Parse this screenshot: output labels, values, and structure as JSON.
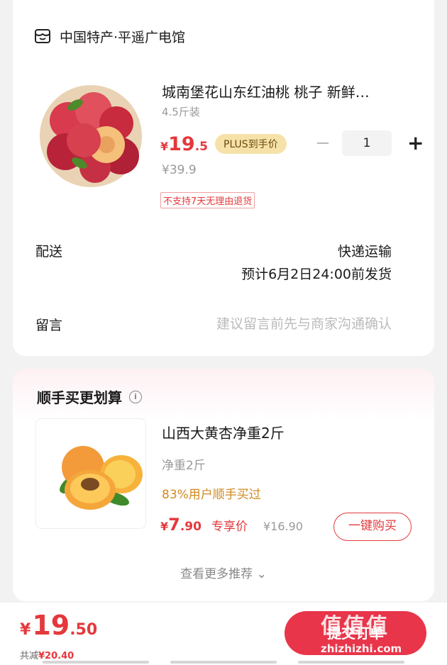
{
  "shop": {
    "icon": "shop-icon",
    "name": "中国特产·平遥广电馆"
  },
  "product": {
    "title": "城南堡花山东红油桃 桃子 新鲜…",
    "spec": "4.5斤装",
    "price_currency": "¥",
    "price_int": "19",
    "price_dec": ".5",
    "plus_tag": "PLUS到手价",
    "original_price": "¥39.9",
    "return_notice": "不支持7天无理由退货",
    "quantity": "1",
    "minus": "−",
    "plus": "+"
  },
  "delivery": {
    "label": "配送",
    "method": "快递运输",
    "eta": "预计6月2日24:00前发货"
  },
  "message": {
    "label": "留言",
    "placeholder": "建议留言前先与商家沟通确认"
  },
  "recommend": {
    "title": "顺手买更划算",
    "item": {
      "name": "山西大黄杏净重2斤",
      "spec": "净重2斤",
      "bought": "83%用户顺手买过",
      "price_currency": "¥",
      "price_int": "7",
      "price_dec": ".90",
      "exclusive_label": "专享价",
      "original_price": "¥16.90",
      "buy_label": "一键购买"
    },
    "more_label": "查看更多推荐 ⌄"
  },
  "footer": {
    "total_currency": "¥",
    "total_int": "19",
    "total_dec": ".50",
    "saved_prefix": "共减",
    "saved_amount": "¥20.40",
    "submit_label": "提交订单"
  },
  "watermark": {
    "logo": "值值值",
    "url": "zhizhizhi.com"
  },
  "colors": {
    "accent": "#e4393c",
    "plus_bg": "#f6e2a8",
    "submit_bg": "#e8354a",
    "bought": "#d08a20"
  }
}
